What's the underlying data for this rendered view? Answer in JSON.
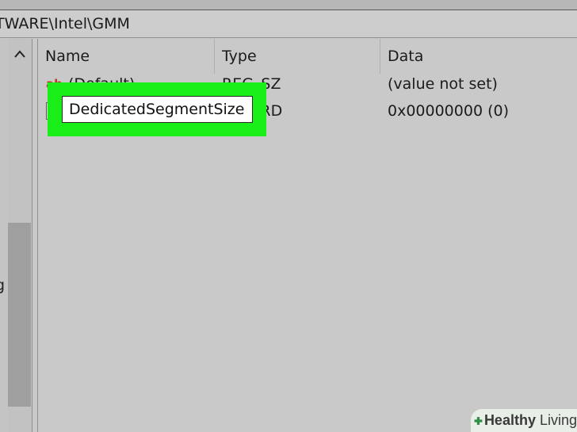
{
  "address_bar": {
    "path": "TWARE\\Intel\\GMM"
  },
  "tree_pane": {
    "partial_text": "g"
  },
  "columns": [
    {
      "label": "Name"
    },
    {
      "label": "Type"
    },
    {
      "label": "Data"
    }
  ],
  "rows": [
    {
      "icon": "ab-string-value-icon",
      "name": "(Default)",
      "type": "REG_SZ",
      "data": "(value not set)"
    },
    {
      "icon": "binary-value-icon",
      "name": "",
      "type": "DWORD",
      "data": "0x00000000 (0)"
    }
  ],
  "rename_input": {
    "value": "DedicatedSegmentSize"
  },
  "icons": {
    "string_value": "ab-icon",
    "binary_value": "binary-icon",
    "scroll_up": "chevron-up-icon"
  },
  "watermark": {
    "brand_bold": "Healthy",
    "brand_rest": " Living"
  },
  "colors": {
    "highlight": "#19ee19",
    "background": "#c8c8c8"
  }
}
